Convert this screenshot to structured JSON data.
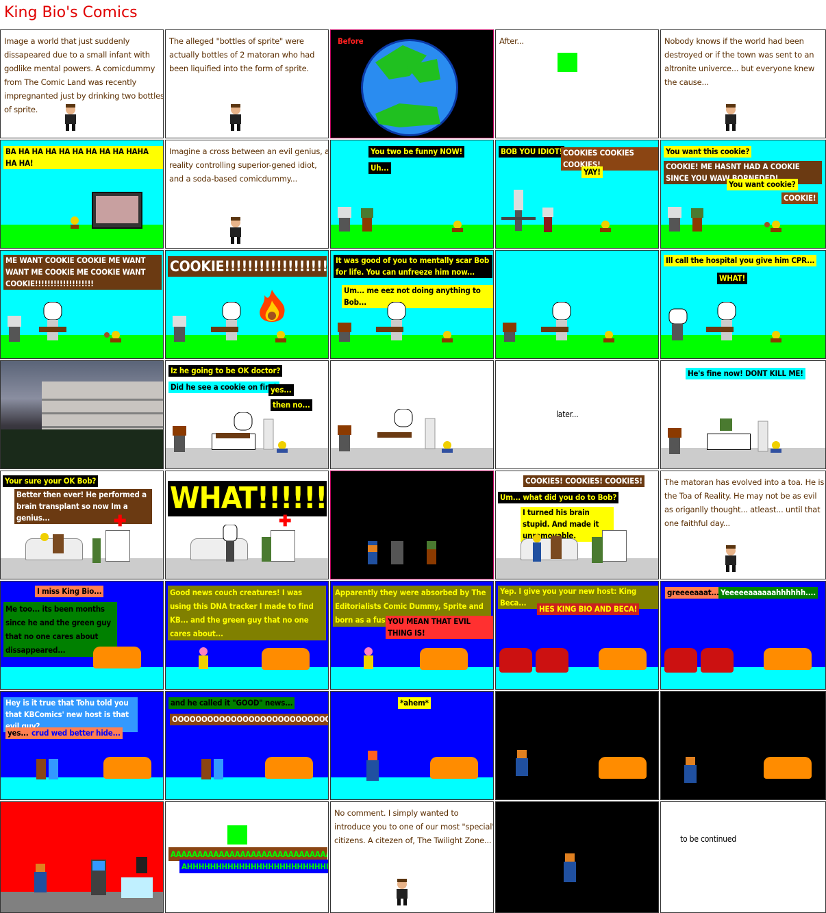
{
  "header": {
    "title": "King Bio's Comics"
  },
  "colors": {
    "sky": "#00ffff",
    "grass": "#00ff00",
    "floor": "#cccccc",
    "blue_bg": "#0000ff",
    "black_bg": "#000000",
    "red_bg": "#ff0000",
    "title": "#e00000"
  },
  "panels": {
    "p1": "Image a world that just suddenly dissapeared due to a small infant with godlike mental powers. A comicdummy from The Comic Land was recently impregnanted just by drinking two bottles of sprite.",
    "p2": "The alleged \"bottles of sprite\" were actually bottles of 2 matoran who had been liquified into the form of sprite.",
    "p3": "Before",
    "p4": "After...",
    "p5": "Nobody knows if the world had been destroyed or if the town was sent to an altronite univerce... but everyone knew the cause...",
    "p6": "BA HA HA HA HA HA HA HA HA HAHA HA HA!",
    "p7": "Imagine a cross between an evil genius, a reality controlling superior-gened idiot, and a soda-based comicdummy...",
    "p8a": "You two be funny NOW!",
    "p8b": "Uh...",
    "p9a": "BOB YOU IDIOT!",
    "p9b": "COOKIES COOKIES COOKIES!",
    "p9c": "YAY!",
    "p10a": "You want this cookie?",
    "p10b": "COOKIE! ME HASNT HAD A COOKIE SINCE YOU WAW BORNEDED!",
    "p10c": "You want cookie?",
    "p10d": "COOKIE!",
    "p11": "ME WANT COOKIE COOKIE ME WANT WANT ME COOKIE ME COOKIE WANT COOKIE!!!!!!!!!!!!!!!!!!!",
    "p12": "COOKIE!!!!!!!!!!!!!!!!!!!!!!!!!!!!!!!!!",
    "p13a": "It was good of you to mentally scar Bob for life. You can unfreeze him now...",
    "p13b": "Um... me eez not doing anything to Bob...",
    "p15a": "Ill call the hospital you give him CPR...",
    "p15b": "WHAT!",
    "p17a": "Iz he going to be OK doctor?",
    "p17b": "Did he see a cookie on fire?",
    "p17c": "yes...",
    "p17d": "then no...",
    "p19": "later...",
    "p20": "He's fine now! DONT KILL ME!",
    "p21a": "Your sure your OK Bob?",
    "p21b": "Better then ever! He performed a brain transplant so now Im a genius...",
    "p22": "WHAT!!!!!!!!!!!",
    "p24a": "COOKIES! COOKIES! COOKIES!",
    "p24b": "Um... what did you do to Bob?",
    "p24c": "I turned his brain stupid. And made it unremovable.",
    "p25": "The matoran has evolved into a toa. He is the Toa of Reality. He may not be as evil as origanlly thought... atleast... until that one faithful day...",
    "p26a": "I miss King Bio...",
    "p26b": "Me too... its been months since he and the green guy that no one cares about dissappeared...",
    "p27": "Good news couch creatures! I was using this DNA tracker I made to find KB... and the green guy that no one cares about...",
    "p28a": "Apparently they were absorbed by The Editorialists Comic Dummy, Sprite and born as a fusion thing.",
    "p28b": "YOU MEAN THAT EVIL THING IS!",
    "p29a": "Yep. I give you your new host: King Beca...",
    "p29b": "HES KING BIO AND BECA!",
    "p30a": "greeeeaaat...",
    "p30b": "Yeeeeeaaaaaahhhhhh....",
    "p31a": "Hey is it true that Tohu told you that KBComics' new host is that evil guy?",
    "p31b": "yes...",
    "p31c": "crud wed better hide...",
    "p32a": "and he called it \"GOOD\" news...",
    "p32b": "OOOOOOOOOOOOOOOOOOOOOOOOOOOOOKay",
    "p33": "*ahem*",
    "p37a": "AAAAAAAAAAAAAAAAAAAAAAAAAAAAAAAAAAAAA",
    "p37b": "AHHHHHHHHHHHHHHHHHHHHHHHHHHHHHHHHHHH",
    "p38": "No comment. I simply wanted to introduce you to one of our most \"special\" citizens. A citezen of, The Twilight Zone...",
    "p40": "to be continued"
  }
}
